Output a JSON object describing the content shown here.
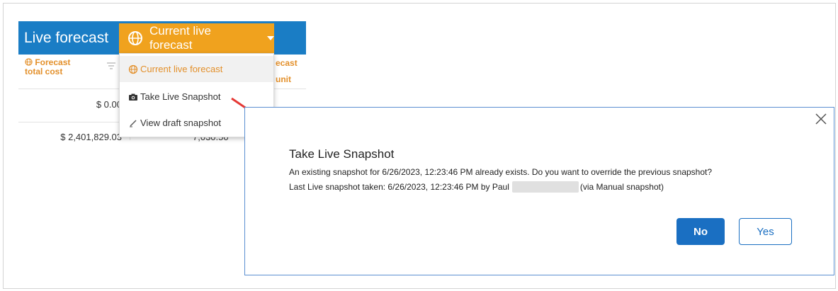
{
  "header": {
    "title": "Live forecast",
    "dropdown_label": "Current live forecast"
  },
  "columns": {
    "col1_line1": "Forecast",
    "col1_line2": "total cost",
    "col2_line1": "ecast",
    "col2_line2": "unit"
  },
  "rows": [
    {
      "cost": "$ 0.00"
    },
    {
      "cost": "$ 2,401,829.03",
      "partial_value": "7,030.50"
    }
  ],
  "menu": {
    "items": [
      {
        "label": "Current live forecast",
        "icon": "globe-icon",
        "selected": true
      },
      {
        "label": "Take Live Snapshot",
        "icon": "camera-icon",
        "selected": false
      },
      {
        "label": "View draft snapshot",
        "icon": "pencil-icon",
        "selected": false
      }
    ]
  },
  "dialog": {
    "title": "Take Live Snapshot",
    "message": "An existing snapshot for 6/26/2023, 12:23:46 PM already exists. Do you want to override the previous snapshot?",
    "last_prefix": "Last Live snapshot taken: 6/26/2023, 12:23:46 PM by Paul",
    "last_suffix": "(via Manual snapshot)",
    "no_label": "No",
    "yes_label": "Yes"
  },
  "colors": {
    "header_blue": "#1a7dc5",
    "accent_orange": "#f0a21e",
    "button_blue": "#1a6fc2",
    "annotation_red": "#e53935"
  }
}
